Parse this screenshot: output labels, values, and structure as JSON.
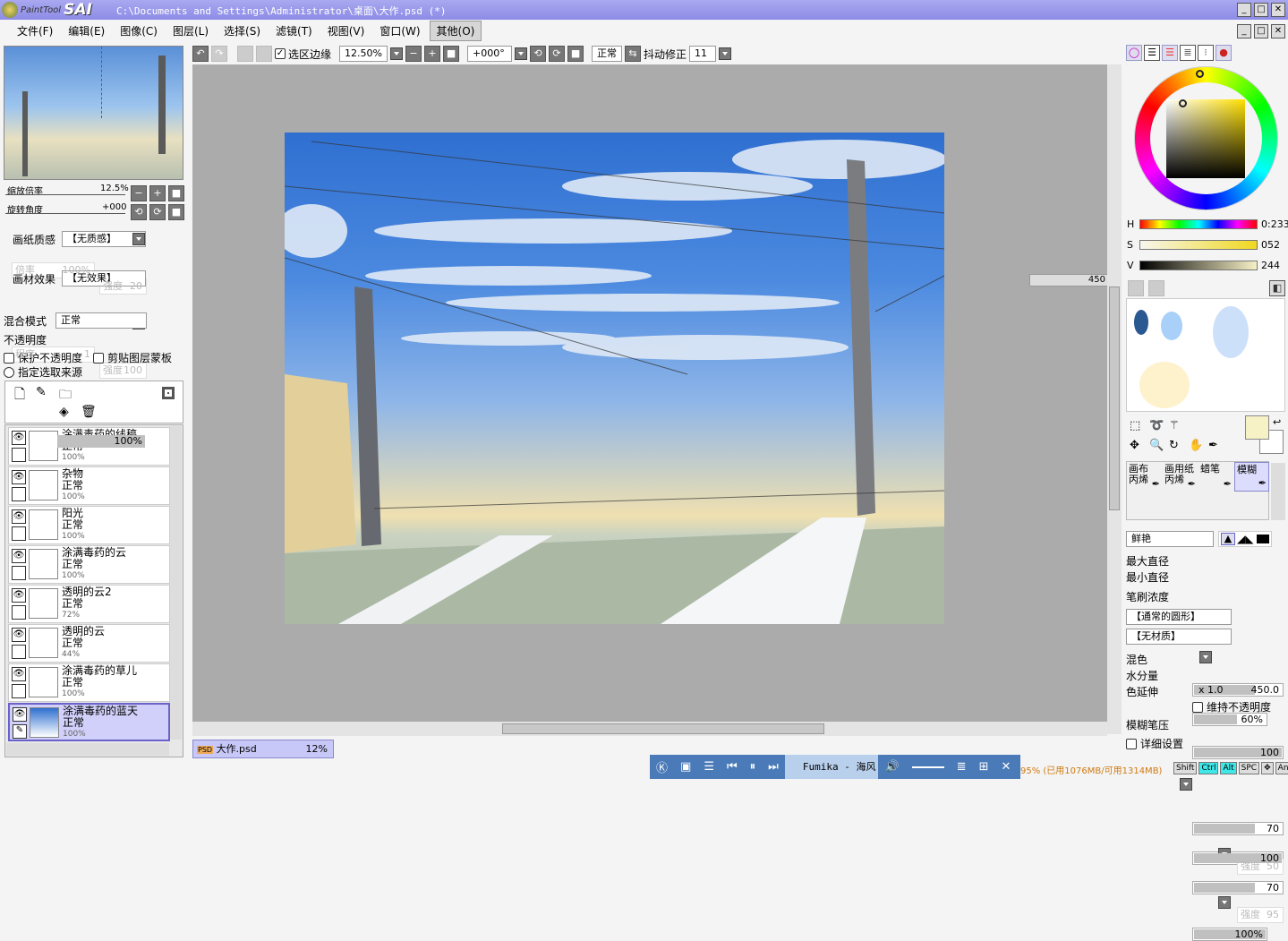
{
  "app": {
    "logo_small": "PaintTool",
    "logo_big": "SAI",
    "title": "C:\\Documents and Settings\\Administrator\\桌面\\大作.psd (*)"
  },
  "menu": [
    "文件(F)",
    "编辑(E)",
    "图像(C)",
    "图层(L)",
    "选择(S)",
    "滤镜(T)",
    "视图(V)",
    "窗口(W)",
    "其他(O)"
  ],
  "toolbar": {
    "selection_edge": "选区边缘",
    "zoom": "12.50%",
    "rotation": "+000°",
    "blend": "正常",
    "stabilizer_label": "抖动修正",
    "stabilizer": "11"
  },
  "nav": {
    "zoom_label": "缩放倍率",
    "zoom": "12.5%",
    "rotate_label": "旋转角度",
    "rotate": "+000"
  },
  "paper": {
    "texture_label": "画纸质感",
    "texture": "【无质感】",
    "scale_label": "倍率",
    "scale": "100%",
    "strength_label": "强度",
    "strength": "20",
    "effect_label": "画材效果",
    "effect": "【无效果】",
    "degree_label": "程度",
    "degree": "1",
    "strength2_label": "强度",
    "strength2": "100"
  },
  "layer_props": {
    "blend_label": "混合模式",
    "blend": "正常",
    "opacity_label": "不透明度",
    "opacity": "100%",
    "protect": "保护不透明度",
    "clip": "剪贴图层蒙板",
    "source": "指定选取来源"
  },
  "layers": [
    {
      "name": "涂满毒药的线稿",
      "mode": "正常",
      "opacity": "100%"
    },
    {
      "name": "杂物",
      "mode": "正常",
      "opacity": "100%"
    },
    {
      "name": "阳光",
      "mode": "正常",
      "opacity": "100%"
    },
    {
      "name": "涂满毒药的云",
      "mode": "正常",
      "opacity": "100%"
    },
    {
      "name": "透明的云2",
      "mode": "正常",
      "opacity": "72%"
    },
    {
      "name": "透明的云",
      "mode": "正常",
      "opacity": "44%"
    },
    {
      "name": "涂满毒药的草儿",
      "mode": "正常",
      "opacity": "100%"
    },
    {
      "name": "涂满毒药的蓝天",
      "mode": "正常",
      "opacity": "100%",
      "selected": true
    }
  ],
  "canvas": {
    "size_readout": "450"
  },
  "file_tab": {
    "name": "大作.psd",
    "zoom": "12%"
  },
  "color": {
    "h_label": "H",
    "h": "0:233",
    "s_label": "S",
    "s": "052",
    "v_label": "V",
    "v": "244",
    "swatch": "#f7f1c6"
  },
  "tools": [
    {
      "l1": "画布",
      "l2": "丙烯"
    },
    {
      "l1": "画用纸",
      "l2": "丙烯"
    },
    {
      "l1": "蜡笔",
      "l2": ""
    },
    {
      "l1": "模糊",
      "l2": ""
    }
  ],
  "brush": {
    "mode": "鲜艳",
    "max_label": "最大直径",
    "max_mult": "x 1.0",
    "max": "450.0",
    "min_label": "最小直径",
    "min": "60%",
    "density_label": "笔刷浓度",
    "density": "100",
    "shape": "【通常的圆形】",
    "shape_strength_label": "强度",
    "shape_strength": "50",
    "texture": "【无材质】",
    "texture_strength_label": "强度",
    "texture_strength": "95",
    "blend_label": "混色",
    "blend": "70",
    "water_label": "水分量",
    "water": "100",
    "stretch_label": "色延伸",
    "stretch": "70",
    "keep_opacity": "维持不透明度",
    "blur_label": "模糊笔压",
    "blur": "100%",
    "detail": "详细设置"
  },
  "status": {
    "memory": "95% (已用1076MB/可用1314MB)",
    "keys": [
      "Shift",
      "Ctrl",
      "Alt",
      "SPC",
      "✥",
      "Any",
      "✎"
    ]
  },
  "player": {
    "now_playing": "Fumika - 海风"
  }
}
